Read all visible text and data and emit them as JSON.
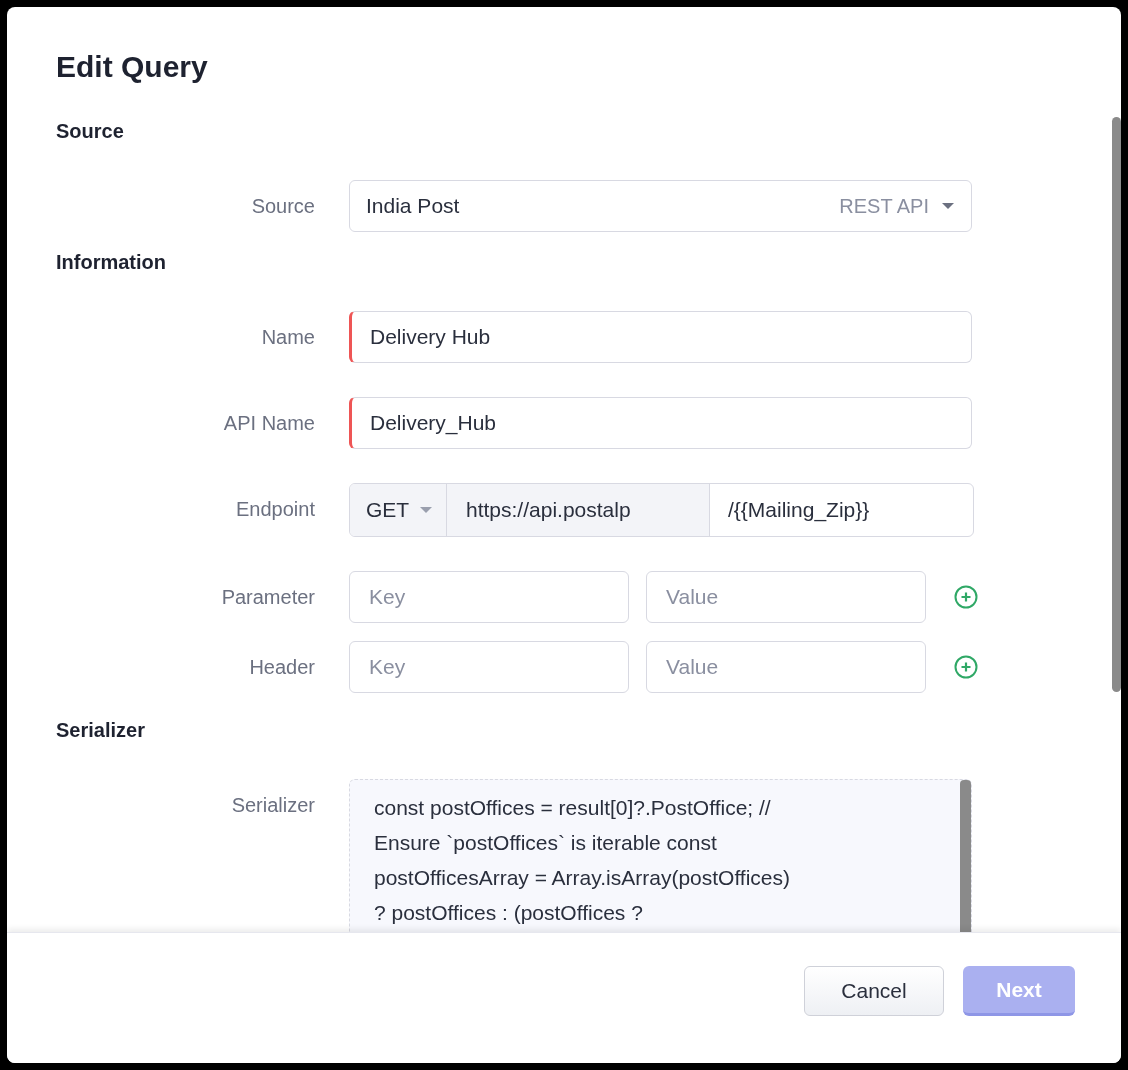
{
  "dialog": {
    "title": "Edit Query"
  },
  "sections": [
    {
      "heading": "Source",
      "rows": [
        {
          "kind": "select",
          "label": "Source",
          "value": "India Post",
          "type_label": "REST API"
        }
      ]
    },
    {
      "heading": "Information",
      "rows": [
        {
          "kind": "text",
          "label": "Name",
          "value": "Delivery Hub",
          "required": true
        },
        {
          "kind": "text",
          "label": "API Name",
          "value": "Delivery_Hub",
          "required": true
        },
        {
          "kind": "endpoint",
          "label": "Endpoint",
          "method": "GET",
          "base_url": "https://api.postalp",
          "path": "/{{Mailing_Zip}}"
        },
        {
          "kind": "pair",
          "label": "Parameter",
          "key_placeholder": "Key",
          "value_placeholder": "Value"
        },
        {
          "kind": "pair",
          "label": "Header",
          "key_placeholder": "Key",
          "value_placeholder": "Value"
        }
      ]
    },
    {
      "heading": "Serializer",
      "rows": [
        {
          "kind": "code",
          "label": "Serializer",
          "lines": [
            "const postOffices = result[0]?.PostOffice; //",
            "Ensure `postOffices` is iterable const",
            "postOfficesArray = Array.isArray(postOffices)",
            "? postOffices : (postOffices ?"
          ]
        }
      ]
    }
  ],
  "buttons": [
    {
      "label": "Cancel",
      "kind": "secondary",
      "disabled": false
    },
    {
      "label": "Next",
      "kind": "primary",
      "disabled": true
    }
  ]
}
